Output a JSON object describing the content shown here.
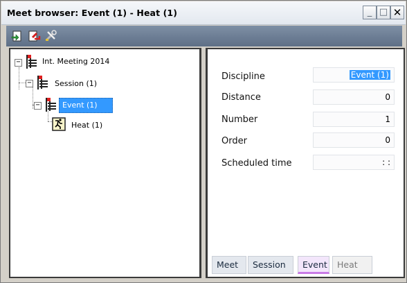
{
  "window": {
    "title": "Meet browser: Event (1) - Heat (1)",
    "minimize_glyph": "_",
    "maximize_glyph": "□",
    "close_glyph": "✕"
  },
  "toolbar": {
    "icons": [
      "add-item-icon",
      "delete-item-icon",
      "settings-tools-icon"
    ]
  },
  "tree": {
    "nodes": [
      {
        "label": "Int. Meeting  2014",
        "expander": "−",
        "icon": "meet-icon"
      },
      {
        "label": "Session (1)",
        "expander": "−",
        "icon": "session-icon"
      },
      {
        "label": "Event (1)",
        "expander": "−",
        "icon": "event-icon",
        "selected": true
      },
      {
        "label": "Heat (1)",
        "icon": "heat-icon"
      }
    ]
  },
  "form": {
    "fields": [
      {
        "label": "Discipline",
        "value": "Event (1)"
      },
      {
        "label": "Distance",
        "value": "0"
      },
      {
        "label": "Number",
        "value": "1"
      },
      {
        "label": "Order",
        "value": "0"
      },
      {
        "label": "Scheduled time",
        "value": ":  :"
      }
    ]
  },
  "tabs": [
    {
      "label": "Meet"
    },
    {
      "label": "Session"
    },
    {
      "label": "Event"
    },
    {
      "label": "Heat"
    }
  ],
  "colors": {
    "toolbar": "#6a7b92",
    "selection": "#3399ff",
    "event_tab_accent": "#c97be6"
  }
}
